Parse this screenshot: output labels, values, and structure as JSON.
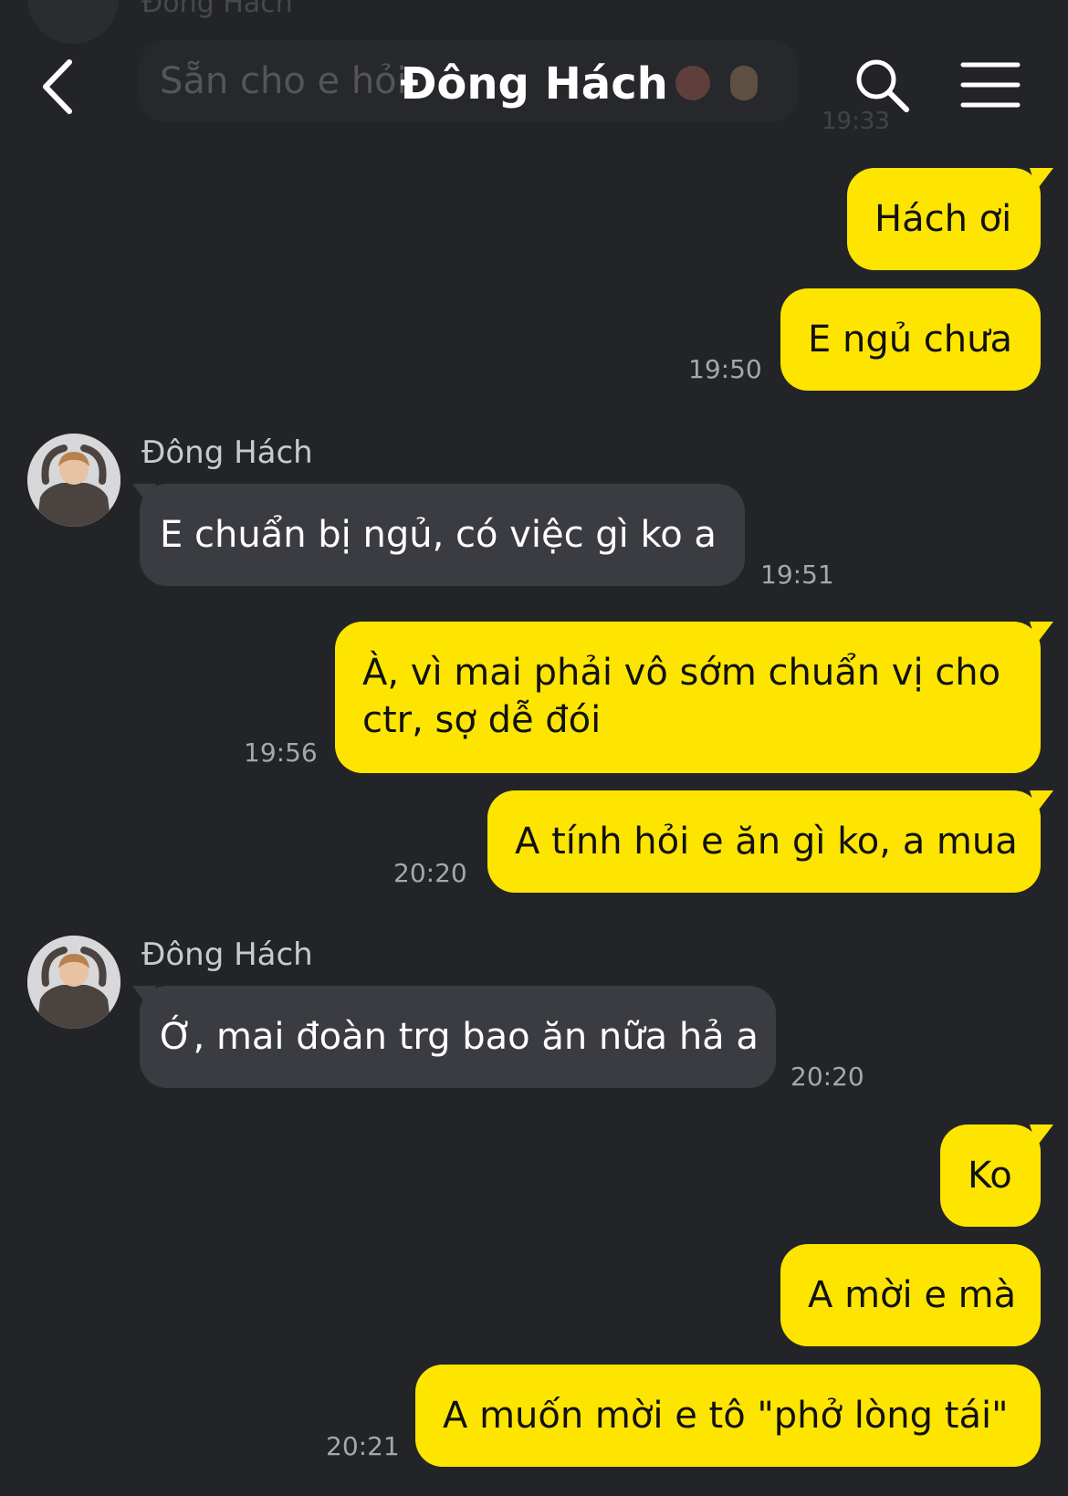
{
  "header": {
    "title": "Đông Hách",
    "back_icon": "chevron-left-icon",
    "search_icon": "search-icon",
    "menu_icon": "hamburger-menu-icon"
  },
  "previous_message": {
    "sender": "Đông Hách",
    "text": "Sẵn cho e hỏi",
    "time": "19:33"
  },
  "colors": {
    "background": "#232428",
    "outgoing_bubble": "#fee500",
    "incoming_bubble": "#3b3c41",
    "timestamp": "#a6a7ab"
  },
  "messages": [
    {
      "direction": "out",
      "text": "Hách ơi"
    },
    {
      "direction": "out",
      "text": "E ngủ chưa",
      "time": "19:50"
    },
    {
      "direction": "in",
      "sender": "Đông Hách",
      "text": "E chuẩn bị ngủ, có việc gì ko a",
      "time": "19:51"
    },
    {
      "direction": "out",
      "line1": "À, vì mai phải vô sớm chuẩn vị cho",
      "line2": "ctr, sợ dễ đói",
      "time": "19:56"
    },
    {
      "direction": "out",
      "text": "A tính hỏi e ăn gì ko, a mua",
      "time": "20:20"
    },
    {
      "direction": "in",
      "sender": "Đông Hách",
      "text": "Ớ, mai đoàn trg bao ăn nữa hả a",
      "time": "20:20"
    },
    {
      "direction": "out",
      "text": "Ko"
    },
    {
      "direction": "out",
      "text": "A mời e mà"
    },
    {
      "direction": "out",
      "text": "A muốn mời e tô \"phở lòng tái\"",
      "time": "20:21"
    }
  ]
}
